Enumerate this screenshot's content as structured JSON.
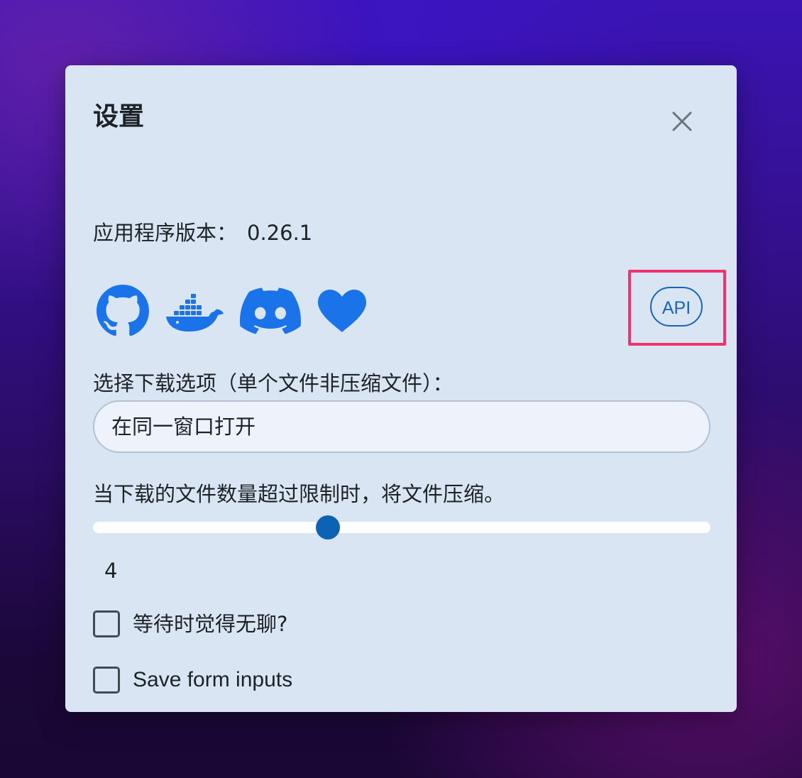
{
  "dialog": {
    "title": "设置"
  },
  "version": {
    "label": "应用程序版本：",
    "value": "0.26.1"
  },
  "links": {
    "items": [
      {
        "icon": "github-icon"
      },
      {
        "icon": "docker-icon"
      },
      {
        "icon": "discord-icon"
      },
      {
        "icon": "heart-icon"
      }
    ],
    "api_label": "API"
  },
  "download": {
    "label": "选择下载选项（单个文件非压缩文件）：",
    "selected": "在同一窗口打开"
  },
  "zip": {
    "label": "当下载的文件数量超过限制时，将文件压缩。",
    "value": "4"
  },
  "checkboxes": {
    "bored_label": "等待时觉得无聊?",
    "save_inputs_label": "Save form inputs"
  },
  "colors": {
    "accent": "#1565c0",
    "icon_blue": "#1a73e8",
    "highlight": "#f0336c",
    "dialog_bg": "#d9e5f3"
  }
}
